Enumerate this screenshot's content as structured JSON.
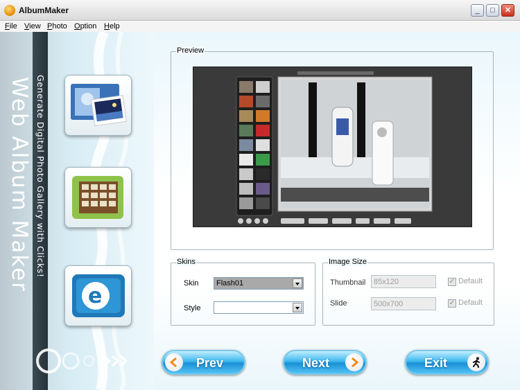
{
  "window": {
    "title": "AlbumMaker",
    "minimize_label": "_",
    "maximize_label": "□",
    "close_label": "✕"
  },
  "menu": [
    {
      "label": "File"
    },
    {
      "label": "View"
    },
    {
      "label": "Photo"
    },
    {
      "label": "Option"
    },
    {
      "label": "Help"
    }
  ],
  "sidebar": {
    "title": "Web Album Maker",
    "subtitle": "Generate Digital Photo Gallery with Clicks!",
    "tiles": [
      {
        "icon": "photo-film-icon"
      },
      {
        "icon": "stamp-gallery-icon"
      },
      {
        "icon": "web-export-icon"
      }
    ]
  },
  "preview": {
    "label": "Preview"
  },
  "skins": {
    "label": "Skins",
    "skin_label": "Skin",
    "skin_value": "Flash01",
    "style_label": "Style",
    "style_value": ""
  },
  "image_size": {
    "label": "Image Size",
    "thumbnail_label": "Thumbnail",
    "thumbnail_value": "85x120",
    "thumbnail_default_label": "Default",
    "thumbnail_default_checked": true,
    "slide_label": "Slide",
    "slide_value": "500x700",
    "slide_default_label": "Default",
    "slide_default_checked": true
  },
  "buttons": {
    "prev_label": "Prev",
    "next_label": "Next",
    "exit_label": "Exit"
  },
  "colors": {
    "accent": "#1a8fd6",
    "button_arrow": "#f08a1a"
  }
}
